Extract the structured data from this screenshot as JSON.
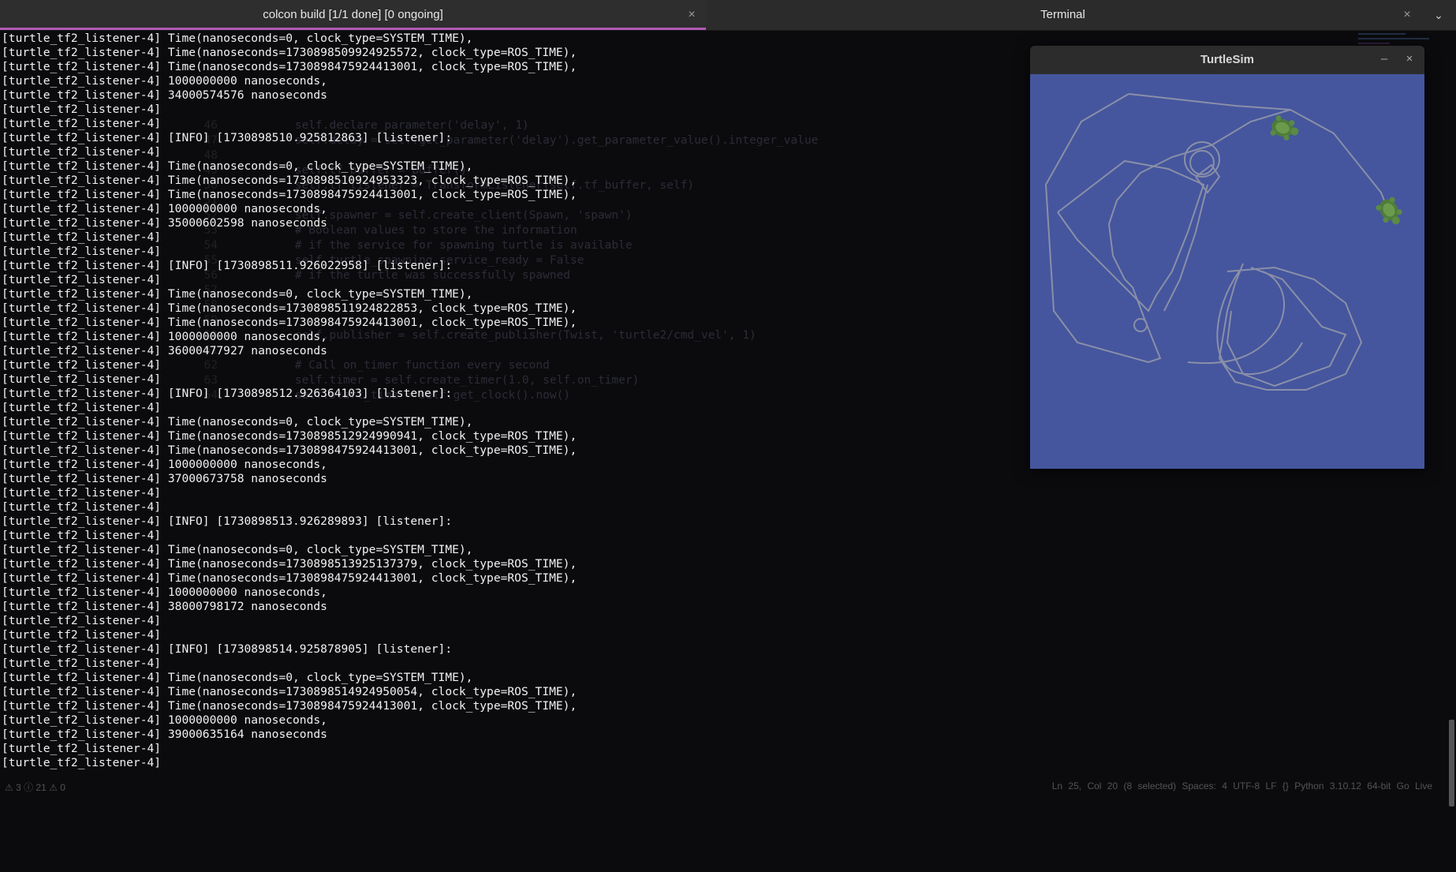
{
  "tabs": [
    {
      "label": "colcon build [1/1 done] [0 ongoing]",
      "active": true
    },
    {
      "label": "Terminal",
      "active": false
    }
  ],
  "terminal_lines": [
    "[turtle_tf2_listener-4] Time(nanoseconds=0, clock_type=SYSTEM_TIME),",
    "[turtle_tf2_listener-4] Time(nanoseconds=1730898509924925572, clock_type=ROS_TIME),",
    "[turtle_tf2_listener-4] Time(nanoseconds=1730898475924413001, clock_type=ROS_TIME),",
    "[turtle_tf2_listener-4] 1000000000 nanoseconds,",
    "[turtle_tf2_listener-4] 34000574576 nanoseconds",
    "[turtle_tf2_listener-4]",
    "[turtle_tf2_listener-4]",
    "[turtle_tf2_listener-4] [INFO] [1730898510.925812863] [listener]:",
    "[turtle_tf2_listener-4]",
    "[turtle_tf2_listener-4] Time(nanoseconds=0, clock_type=SYSTEM_TIME),",
    "[turtle_tf2_listener-4] Time(nanoseconds=1730898510924953323, clock_type=ROS_TIME),",
    "[turtle_tf2_listener-4] Time(nanoseconds=1730898475924413001, clock_type=ROS_TIME),",
    "[turtle_tf2_listener-4] 1000000000 nanoseconds,",
    "[turtle_tf2_listener-4] 35000602598 nanoseconds",
    "[turtle_tf2_listener-4]",
    "[turtle_tf2_listener-4]",
    "[turtle_tf2_listener-4] [INFO] [1730898511.926022958] [listener]:",
    "[turtle_tf2_listener-4]",
    "[turtle_tf2_listener-4] Time(nanoseconds=0, clock_type=SYSTEM_TIME),",
    "[turtle_tf2_listener-4] Time(nanoseconds=1730898511924822853, clock_type=ROS_TIME),",
    "[turtle_tf2_listener-4] Time(nanoseconds=1730898475924413001, clock_type=ROS_TIME),",
    "[turtle_tf2_listener-4] 1000000000 nanoseconds,",
    "[turtle_tf2_listener-4] 36000477927 nanoseconds",
    "[turtle_tf2_listener-4]",
    "[turtle_tf2_listener-4]",
    "[turtle_tf2_listener-4] [INFO] [1730898512.926364103] [listener]:",
    "[turtle_tf2_listener-4]",
    "[turtle_tf2_listener-4] Time(nanoseconds=0, clock_type=SYSTEM_TIME),",
    "[turtle_tf2_listener-4] Time(nanoseconds=1730898512924990941, clock_type=ROS_TIME),",
    "[turtle_tf2_listener-4] Time(nanoseconds=1730898475924413001, clock_type=ROS_TIME),",
    "[turtle_tf2_listener-4] 1000000000 nanoseconds,",
    "[turtle_tf2_listener-4] 37000673758 nanoseconds",
    "[turtle_tf2_listener-4]",
    "[turtle_tf2_listener-4]",
    "[turtle_tf2_listener-4] [INFO] [1730898513.926289893] [listener]:",
    "[turtle_tf2_listener-4]",
    "[turtle_tf2_listener-4] Time(nanoseconds=0, clock_type=SYSTEM_TIME),",
    "[turtle_tf2_listener-4] Time(nanoseconds=1730898513925137379, clock_type=ROS_TIME),",
    "[turtle_tf2_listener-4] Time(nanoseconds=1730898475924413001, clock_type=ROS_TIME),",
    "[turtle_tf2_listener-4] 1000000000 nanoseconds,",
    "[turtle_tf2_listener-4] 38000798172 nanoseconds",
    "[turtle_tf2_listener-4]",
    "[turtle_tf2_listener-4]",
    "[turtle_tf2_listener-4] [INFO] [1730898514.925878905] [listener]:",
    "[turtle_tf2_listener-4]",
    "[turtle_tf2_listener-4] Time(nanoseconds=0, clock_type=SYSTEM_TIME),",
    "[turtle_tf2_listener-4] Time(nanoseconds=1730898514924950054, clock_type=ROS_TIME),",
    "[turtle_tf2_listener-4] Time(nanoseconds=1730898475924413001, clock_type=ROS_TIME),",
    "[turtle_tf2_listener-4] 1000000000 nanoseconds,",
    "[turtle_tf2_listener-4] 39000635164 nanoseconds",
    "[turtle_tf2_listener-4]",
    "[turtle_tf2_listener-4]"
  ],
  "editor_ghost": [
    {
      "n": "46",
      "code": "        self.declare_parameter('delay', 1)"
    },
    {
      "n": "47",
      "code": "        self.delay = self.get_parameter('delay').get_parameter_value().integer_value"
    },
    {
      "n": "48",
      "code": ""
    },
    {
      "n": "49",
      "code": "        self.tf_buffer = Buffer()"
    },
    {
      "n": "50",
      "code": "        self.tf_listener = TransformListener(self.tf_buffer, self)"
    },
    {
      "n": "51",
      "code": ""
    },
    {
      "n": "52",
      "code": "        self.spawner = self.create_client(Spawn, 'spawn')"
    },
    {
      "n": "53",
      "code": "        # Boolean values to store the information"
    },
    {
      "n": "54",
      "code": "        # if the service for spawning turtle is available"
    },
    {
      "n": "55",
      "code": "        self.turtle_spawning_service_ready = False"
    },
    {
      "n": "56",
      "code": "        # if the turtle was successfully spawned"
    },
    {
      "n": "57",
      "code": ""
    },
    {
      "n": "58",
      "code": ""
    },
    {
      "n": "59",
      "code": ""
    },
    {
      "n": "60",
      "code": "        self.publisher = self.create_publisher(Twist, 'turtle2/cmd_vel', 1)"
    },
    {
      "n": "61",
      "code": ""
    },
    {
      "n": "62",
      "code": "        # Call on_timer function every second"
    },
    {
      "n": "63",
      "code": "        self.timer = self.create_timer(1.0, self.on_timer)"
    },
    {
      "n": "64",
      "code": "        self.start_time = self.get_clock().now()"
    }
  ],
  "status_bar": {
    "left": "⚠ 3  ⓘ 21   ⚠ 0",
    "right": "Ln 25, Col 20 (8 selected)   Spaces: 4   UTF-8   LF   {} Python   3.10.12 64-bit   Go Live"
  },
  "turtlesim": {
    "title": "TurtleSim",
    "minimize_glyph": "–",
    "close_glyph": "×",
    "background_color": "#45569e",
    "trail_color": "#8a8fa8"
  },
  "glyphs": {
    "tab_close": "×",
    "tab_menu": "⌄"
  },
  "colors": {
    "terminal_text": "#f2f2f2",
    "active_tab_underline": "#b05ab4",
    "terminal_bg": "#0b0b0e"
  }
}
